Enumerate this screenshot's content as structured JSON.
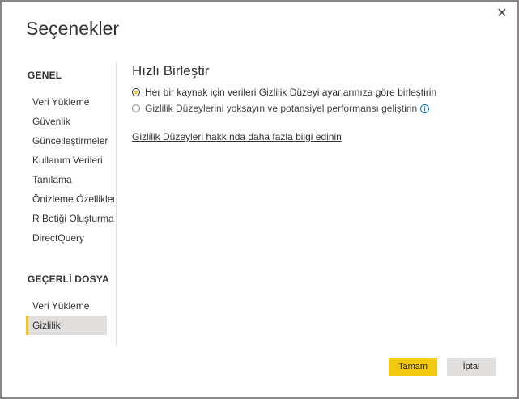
{
  "dialog": {
    "title": "Seçenekler",
    "close_glyph": "✕"
  },
  "sidebar": {
    "general_heading": "GENEL",
    "general_items": [
      {
        "label": "Veri Yükleme"
      },
      {
        "label": "Güvenlik"
      },
      {
        "label": "Güncelleştirmeler"
      },
      {
        "label": "Kullanım Verileri"
      },
      {
        "label": "Tanılama"
      },
      {
        "label": "Önizleme Özellikleri"
      },
      {
        "label": "R Betiği Oluşturma"
      },
      {
        "label": "DirectQuery"
      }
    ],
    "current_file_heading": "GEÇERLİ DOSYA",
    "current_file_items": [
      {
        "label": "Veri Yükleme"
      },
      {
        "label": "Gizlilik",
        "selected": true
      }
    ]
  },
  "content": {
    "title": "Hızlı Birleştir",
    "options": [
      {
        "label": "Her bir kaynak için verileri Gizlilik Düzeyi ayarlarınıza göre birleştirin",
        "checked": true
      },
      {
        "label": "Gizlilik Düzeylerini yoksayın ve potansiyel performansı geliştirin",
        "checked": false
      }
    ],
    "info_glyph": "i",
    "learn_more": "Gizlilik Düzeyleri hakkında daha fazla bilgi edinin"
  },
  "footer": {
    "ok_label": "Tamam",
    "cancel_label": "İptal"
  },
  "colors": {
    "accent": "#f2c811",
    "selected_bg": "#e1dfdd",
    "info": "#0078d4"
  }
}
